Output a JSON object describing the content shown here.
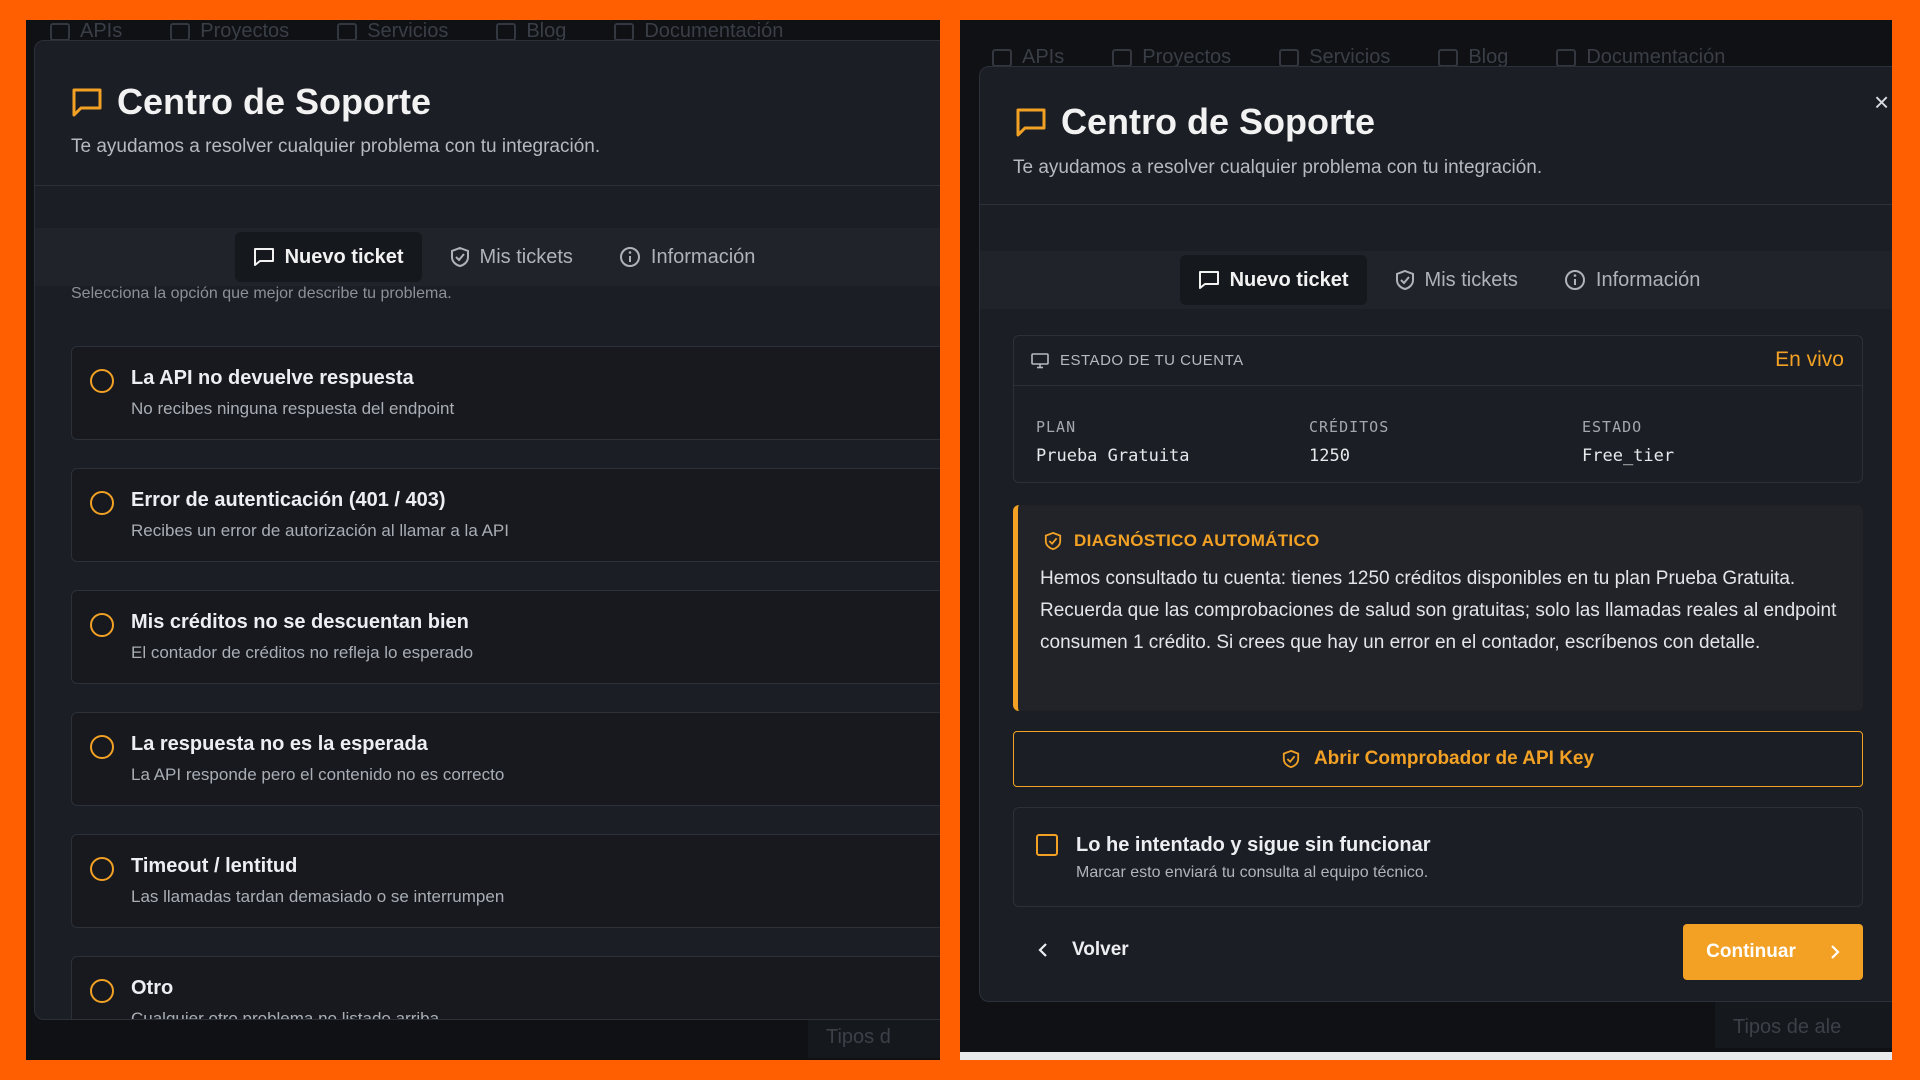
{
  "background_nav": {
    "items": [
      "APIs",
      "Proyectos",
      "Servicios",
      "Blog",
      "Documentación"
    ],
    "left_footer": "Tipos d",
    "right_footer": "Tipos de ale"
  },
  "left": {
    "title": "Centro de Soporte",
    "subtitle": "Te ayudamos a resolver cualquier problema con tu integración.",
    "tabs": [
      {
        "label": "Nuevo ticket",
        "icon": "message-icon",
        "active": true
      },
      {
        "label": "Mis tickets",
        "icon": "shield-icon",
        "active": false
      },
      {
        "label": "Información",
        "icon": "info-icon",
        "active": false
      }
    ],
    "hint": "Selecciona la opción que mejor describe tu problema.",
    "options": [
      {
        "title": "La API no devuelve respuesta",
        "desc": "No recibes ninguna respuesta del endpoint"
      },
      {
        "title": "Error de autenticación (401 / 403)",
        "desc": "Recibes un error de autorización al llamar a la API"
      },
      {
        "title": "Mis créditos no se descuentan bien",
        "desc": "El contador de créditos no refleja lo esperado"
      },
      {
        "title": "La respuesta no es la esperada",
        "desc": "La API responde pero el contenido no es correcto"
      },
      {
        "title": "Timeout / lentitud",
        "desc": "Las llamadas tardan demasiado o se interrumpen"
      },
      {
        "title": "Otro",
        "desc": "Cualquier otro problema no listado arriba"
      }
    ]
  },
  "right": {
    "title": "Centro de Soporte",
    "subtitle": "Te ayudamos a resolver cualquier problema con tu integración.",
    "close": "×",
    "tabs": [
      {
        "label": "Nuevo ticket",
        "icon": "message-icon",
        "active": true
      },
      {
        "label": "Mis tickets",
        "icon": "shield-icon",
        "active": false
      },
      {
        "label": "Información",
        "icon": "info-icon",
        "active": false
      }
    ],
    "account": {
      "label": "ESTADO DE TU CUENTA",
      "live": "En vivo",
      "plan_key": "PLAN",
      "plan_value": "Prueba Gratuita",
      "credits_key": "CRÉDITOS",
      "credits_value": "1250",
      "status_key": "ESTADO",
      "status_value": "Free_tier"
    },
    "diagnostic": {
      "title": "DIAGNÓSTICO AUTOMÁTICO",
      "body": "Hemos consultado tu cuenta: tienes 1250 créditos disponibles en tu plan Prueba Gratuita. Recuerda que las comprobaciones de salud son gratuitas; solo las llamadas reales al endpoint consumen 1 crédito. Si crees que hay un error en el contador, escríbenos con detalle."
    },
    "api_button": "Abrir Comprobador de API Key",
    "tried": {
      "title": "Lo he intentado y sigue sin funcionar",
      "desc": "Marcar esto enviará tu consulta al equipo técnico."
    },
    "back": "Volver",
    "continue": "Continuar"
  },
  "colors": {
    "frame": "#ff5f00",
    "accent": "#f2a124",
    "modal_bg": "#1b1e24",
    "page_bg": "#0f1115"
  }
}
